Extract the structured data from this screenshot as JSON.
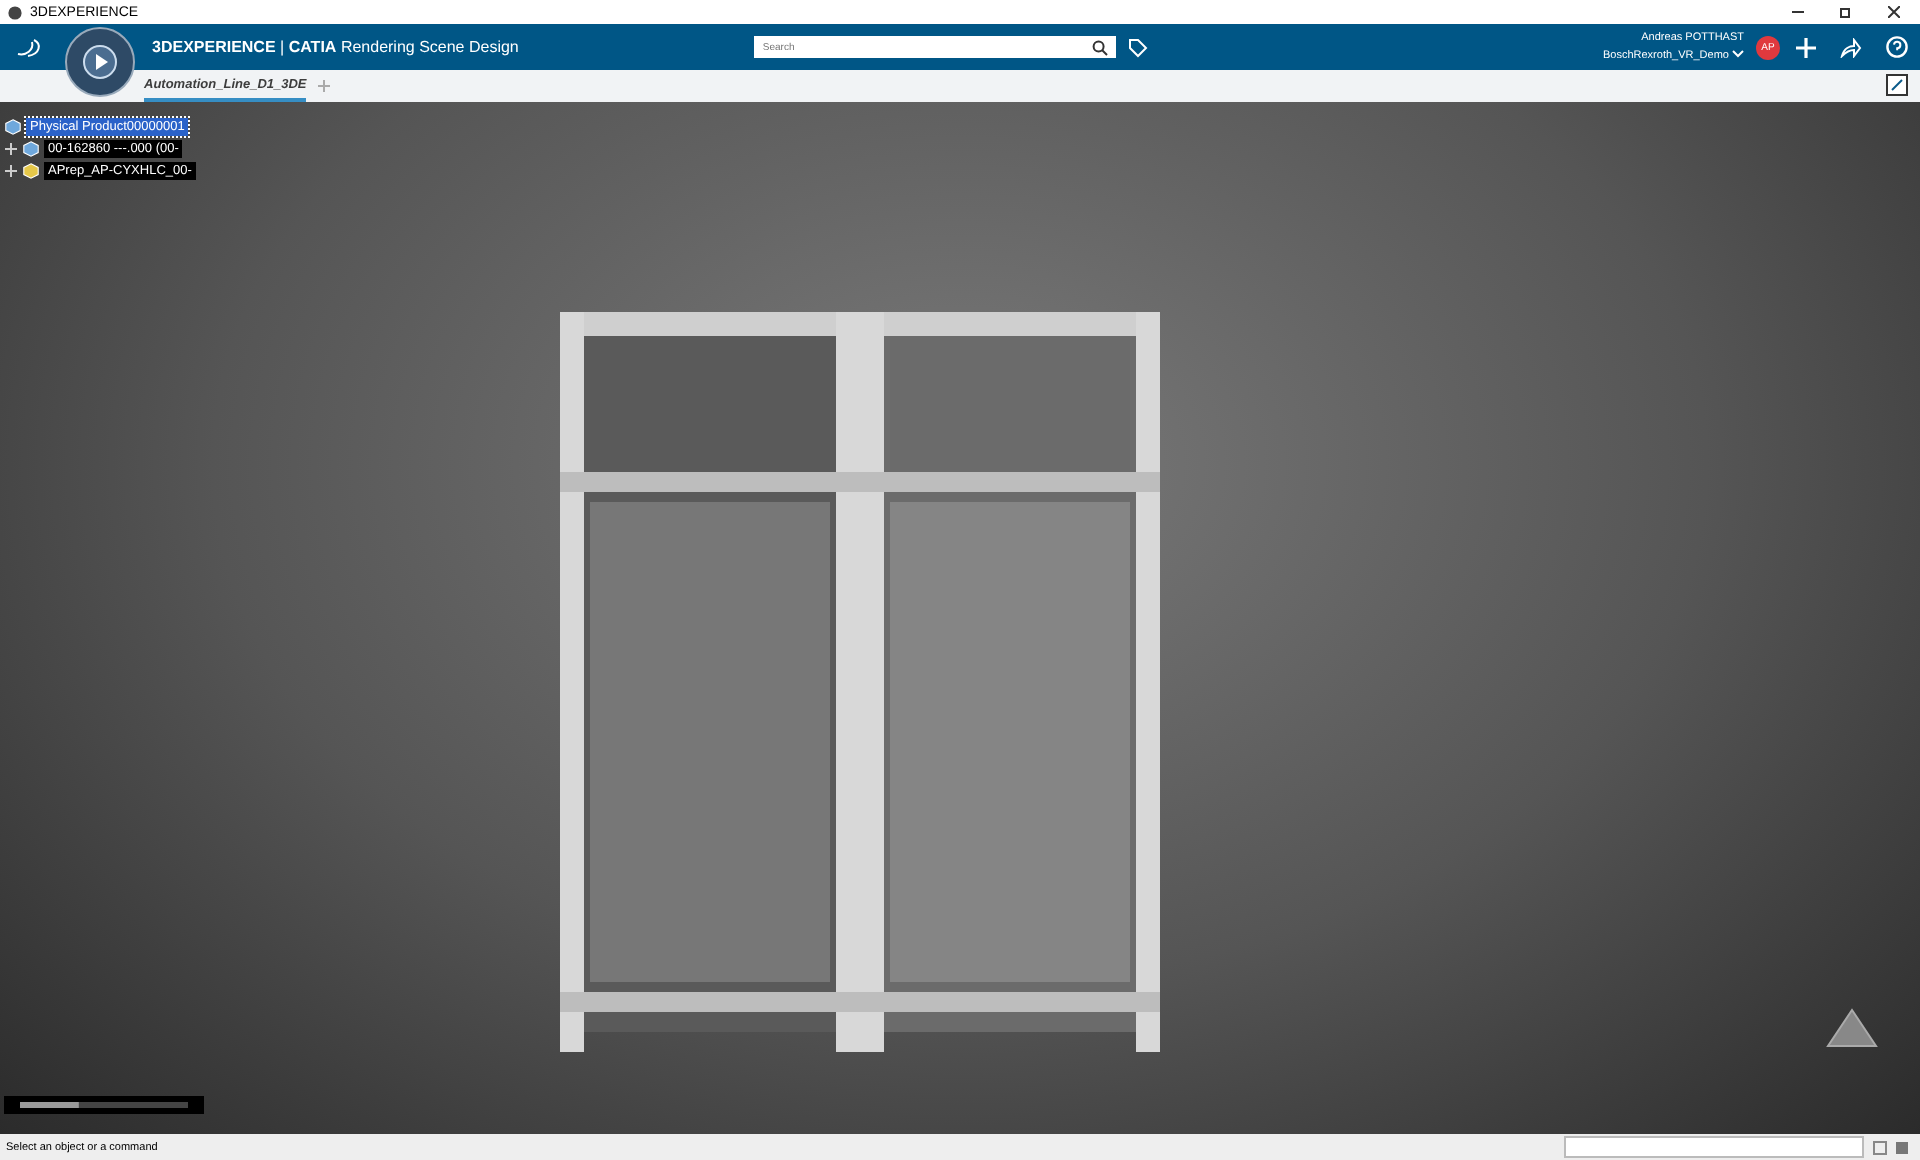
{
  "window": {
    "title": "3DEXPERIENCE"
  },
  "top_bar": {
    "brand": "3DEXPERIENCE",
    "separator": "|",
    "product": "CATIA",
    "app": "Rendering Scene Design",
    "search": {
      "placeholder": "Search"
    },
    "user": "Andreas POTTHAST",
    "tenant": "BoschRexroth_VR_Demo",
    "avatar": "AP"
  },
  "tabs": [
    {
      "label": "Automation_Line_D1_3DE",
      "selected": true
    }
  ],
  "tree": {
    "root": {
      "label": "Physical Product00000001",
      "selected": true,
      "children": [
        {
          "label": "00-162860 ---.000 (00-",
          "selected": false,
          "expanded": false
        },
        {
          "label": "APrep_AP-CYXHLC_00-",
          "selected": false,
          "expanded": false
        }
      ]
    }
  },
  "zoom_slider": {
    "level": 0.35
  },
  "status_bar": {
    "message": "Select an object or a command"
  }
}
